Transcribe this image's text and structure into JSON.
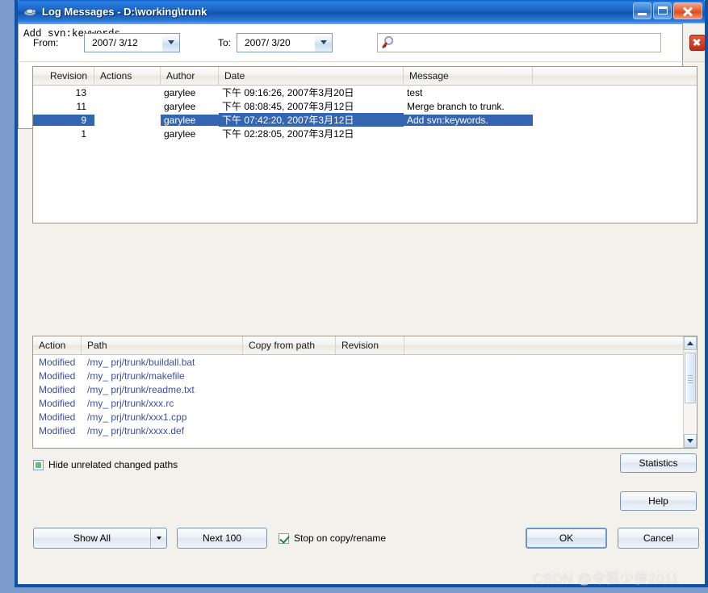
{
  "window": {
    "title": "Log Messages - D:\\working\\trunk",
    "icon": "tortoisesvn-icon",
    "controls": {
      "minimize": "minimize-button",
      "maximize": "maximize-button",
      "close": "close-button"
    }
  },
  "filterbar": {
    "from_label": "From:",
    "from_value": "2007/ 3/12",
    "to_label": "To:",
    "to_value": "2007/ 3/20",
    "search_placeholder": "",
    "search_value": "",
    "search_icon": "magnifier-icon",
    "clear_icon": "clear-filter-icon"
  },
  "log_list": {
    "columns": [
      {
        "label": "Revision"
      },
      {
        "label": "Actions"
      },
      {
        "label": "Author"
      },
      {
        "label": "Date"
      },
      {
        "label": "Message"
      },
      {
        "label": ""
      }
    ],
    "rows": [
      {
        "revision": "13",
        "action_icon": "added-file-icon",
        "author": "garylee",
        "date": "下午 09:16:26, 2007年3月20日",
        "message": "test",
        "selected": false
      },
      {
        "revision": "11",
        "action_icon": "modified-file-icon",
        "author": "garylee",
        "date": "下午 08:08:45, 2007年3月12日",
        "message": "Merge branch to trunk.",
        "selected": false
      },
      {
        "revision": "9",
        "action_icon": "modified-file-icon",
        "author": "garylee",
        "date": "下午 07:42:20, 2007年3月12日",
        "message": "Add svn:keywords.",
        "selected": true
      },
      {
        "revision": "1",
        "action_icon": "added-file-icon",
        "author": "garylee",
        "date": "下午 02:28:05, 2007年3月12日",
        "message": "",
        "selected": false
      }
    ]
  },
  "message_pane": {
    "text": "Add svn:keywords."
  },
  "paths_list": {
    "columns": [
      {
        "label": "Action"
      },
      {
        "label": "Path"
      },
      {
        "label": "Copy from path"
      },
      {
        "label": "Revision"
      },
      {
        "label": ""
      }
    ],
    "rows": [
      {
        "action": "Modified",
        "path": "/my_ prj/trunk/buildall.bat",
        "copy_from_path": "",
        "revision": ""
      },
      {
        "action": "Modified",
        "path": "/my_ prj/trunk/makefile",
        "copy_from_path": "",
        "revision": ""
      },
      {
        "action": "Modified",
        "path": "/my_ prj/trunk/readme.txt",
        "copy_from_path": "",
        "revision": ""
      },
      {
        "action": "Modified",
        "path": "/my_ prj/trunk/xxx.rc",
        "copy_from_path": "",
        "revision": ""
      },
      {
        "action": "Modified",
        "path": "/my_ prj/trunk/xxx1.cpp",
        "copy_from_path": "",
        "revision": ""
      },
      {
        "action": "Modified",
        "path": "/my_ prj/trunk/xxxx.def",
        "copy_from_path": "",
        "revision": ""
      }
    ]
  },
  "options": {
    "hide_unrelated_label": "Hide unrelated changed paths",
    "hide_unrelated_state": "indeterminate",
    "stop_on_copy_label": "Stop on copy/rename",
    "stop_on_copy_state": "checked"
  },
  "buttons": {
    "statistics": "Statistics",
    "help": "Help",
    "show_all": "Show All",
    "next_100": "Next 100",
    "ok": "OK",
    "cancel": "Cancel"
  },
  "watermark": "CSDN @令狐少侠2011",
  "colors": {
    "selection": "#3465b0",
    "path_text": "#3c4fa0",
    "titlebar": "#1c66c6",
    "dialog_bg": "#f2f1ec"
  }
}
